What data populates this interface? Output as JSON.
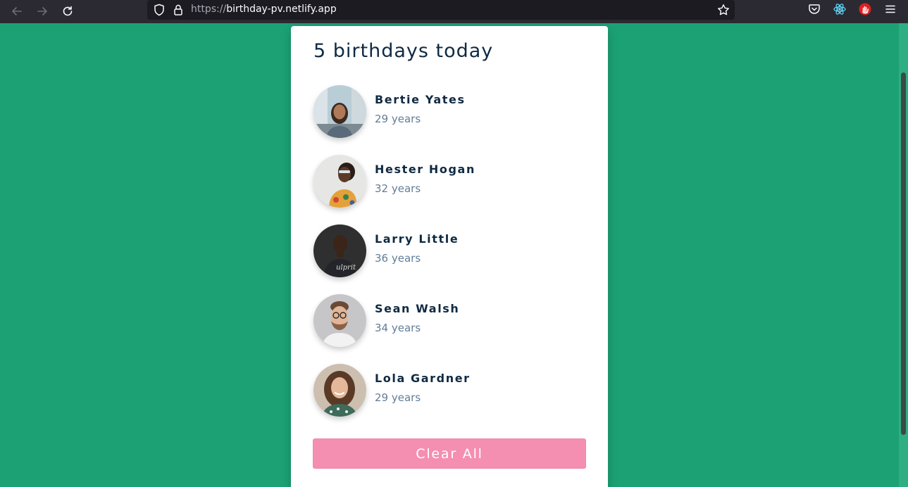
{
  "browser": {
    "url_scheme": "https://",
    "url_host": "birthday-pv.netlify.app",
    "icons": [
      "back-arrow-icon",
      "forward-arrow-icon",
      "reload-icon",
      "shield-icon",
      "lock-icon",
      "star-icon",
      "pocket-icon",
      "react-devtools-icon",
      "extension-hand-icon",
      "menu-icon"
    ]
  },
  "card": {
    "title": "5 birthdays today",
    "people": [
      {
        "name": "Bertie Yates",
        "age": "29 years"
      },
      {
        "name": "Hester Hogan",
        "age": "32 years"
      },
      {
        "name": "Larry Little",
        "age": "36 years"
      },
      {
        "name": "Sean Walsh",
        "age": "34 years"
      },
      {
        "name": "Lola Gardner",
        "age": "29 years"
      }
    ],
    "clear_label": "Clear All"
  },
  "colors": {
    "page_background": "#1ca174",
    "button_background": "#f48fb1",
    "heading_text": "#102a42",
    "age_text": "#617d98"
  }
}
